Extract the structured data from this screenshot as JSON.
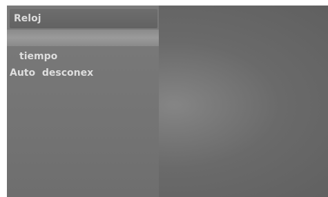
{
  "menu": {
    "title": "Reloj",
    "items": [
      {
        "label": "tiempo"
      },
      {
        "label": "Auto  desconex"
      }
    ]
  }
}
